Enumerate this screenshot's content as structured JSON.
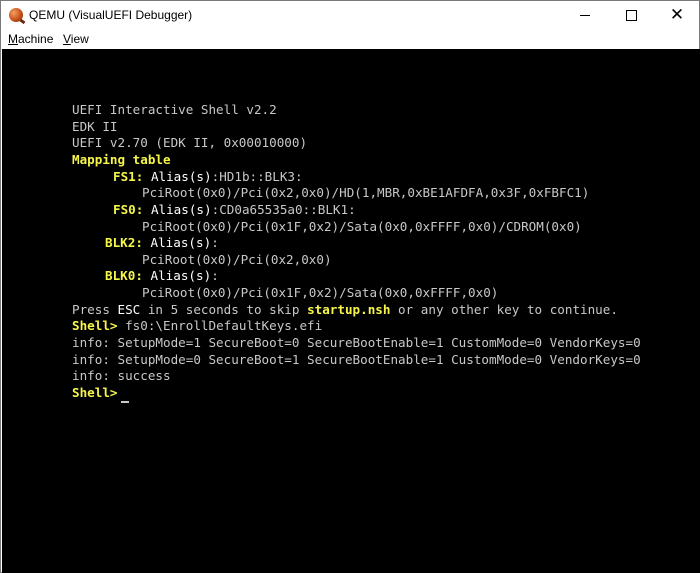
{
  "window": {
    "title": "QEMU (VisualUEFI Debugger)",
    "icon": "qemu-icon"
  },
  "menu": {
    "items": [
      "Machine",
      "View"
    ]
  },
  "console": {
    "header1": "UEFI Interactive Shell v2.2",
    "header2": "EDK II",
    "header3": "UEFI v2.70 (EDK II, 0x00010000)",
    "mapping_title": "Mapping table",
    "fs1_name": "FS1:",
    "fs1_alias_label": "Alias(s)",
    "fs1_alias_value": ":HD1b::BLK3:",
    "fs1_path": "PciRoot(0x0)/Pci(0x2,0x0)/HD(1,MBR,0xBE1AFDFA,0x3F,0xFBFC1)",
    "fs0_name": "FS0:",
    "fs0_alias_label": "Alias(s)",
    "fs0_alias_value": ":CD0a65535a0::BLK1:",
    "fs0_path": "PciRoot(0x0)/Pci(0x1F,0x2)/Sata(0x0,0xFFFF,0x0)/CDROM(0x0)",
    "blk2_name": "BLK2:",
    "blk2_alias_label": "Alias(s)",
    "blk2_alias_value": ":",
    "blk2_path": "PciRoot(0x0)/Pci(0x2,0x0)",
    "blk0_name": "BLK0:",
    "blk0_alias_label": "Alias(s)",
    "blk0_alias_value": ":",
    "blk0_path": "PciRoot(0x0)/Pci(0x1F,0x2)/Sata(0x0,0xFFFF,0x0)",
    "press_prefix": "Press ",
    "press_key": "ESC",
    "press_middle": " in 5 seconds to skip ",
    "press_script": "startup.nsh",
    "press_suffix": " or any other key to continue.",
    "prompt": "Shell>",
    "command": " fs0:\\EnrollDefaultKeys.efi",
    "info1": "info: SetupMode=1 SecureBoot=0 SecureBootEnable=1 CustomMode=0 VendorKeys=0",
    "info2": "info: SetupMode=0 SecureBoot=1 SecureBootEnable=1 CustomMode=0 VendorKeys=0",
    "info3": "info: success",
    "prompt2": "Shell>"
  },
  "colors": {
    "console_bg": "#000000",
    "text_gray": "#c8c8c8",
    "text_yellow": "#f5f54a",
    "text_white": "#ffffff"
  }
}
